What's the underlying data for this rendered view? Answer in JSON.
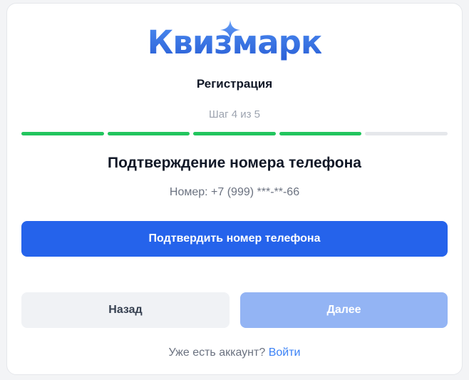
{
  "brand": {
    "logo_text": "Квизмарк",
    "accent_color": "#2563eb",
    "success_color": "#22c55e"
  },
  "header": {
    "title": "Регистрация",
    "step_text": "Шаг 4 из 5"
  },
  "progress": {
    "current_step": 4,
    "total_steps": 5
  },
  "section": {
    "title": "Подтверждение номера телефона",
    "phone_text": "Номер: +7 (999) ***-**-66"
  },
  "actions": {
    "confirm_label": "Подтвердить номер телефона",
    "back_label": "Назад",
    "next_label": "Далее"
  },
  "footer": {
    "prompt_text": "Уже есть аккаунт?",
    "login_link": "Войти"
  },
  "icons": {
    "sparkle": "sparkle-icon"
  }
}
